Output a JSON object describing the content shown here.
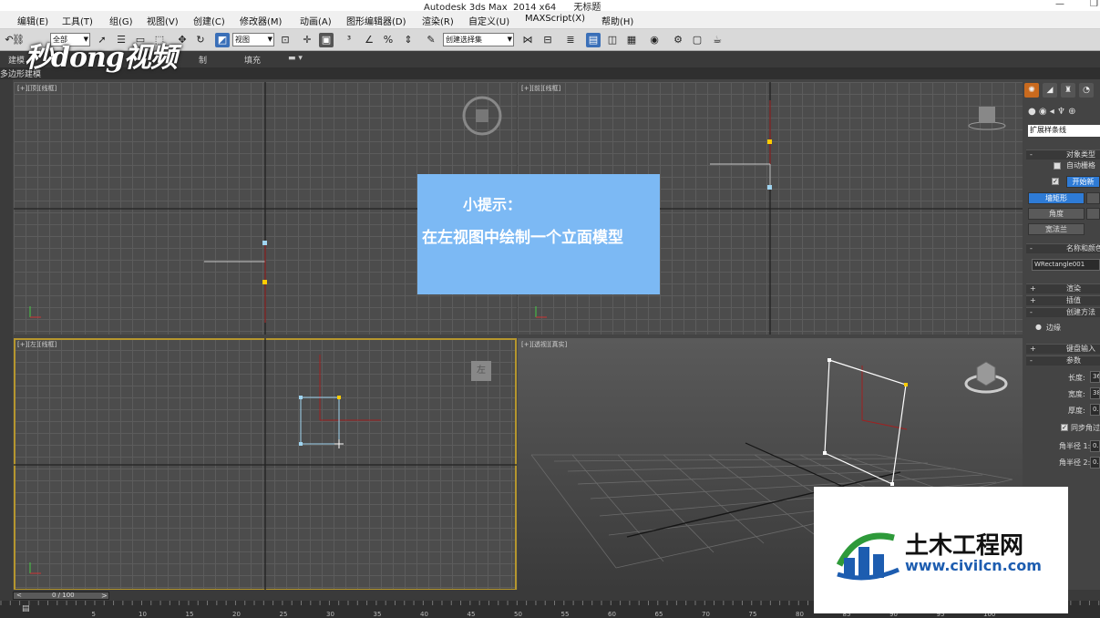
{
  "window": {
    "title": "Autodesk 3ds Max  2014 x64      无标题"
  },
  "menu": [
    "编辑(E)",
    "工具(T)",
    "组(G)",
    "视图(V)",
    "创建(C)",
    "修改器(M)",
    "动画(A)",
    "图形编辑器(D)",
    "渲染(R)",
    "自定义(U)",
    "MAXScript(X)",
    "帮助(H)"
  ],
  "toolbar": {
    "selection_filter": "全部",
    "reference_coord": "视图",
    "named_selection": "创建选择集"
  },
  "ribbon": {
    "tabs": [
      "建模",
      "制",
      "填充"
    ],
    "sub_label": "多边形建模"
  },
  "viewports": [
    {
      "label": "[+][顶][线框]"
    },
    {
      "label": "[+][前][线框]"
    },
    {
      "label": "[+][左][线框]"
    },
    {
      "label": "[+][透视][真实]"
    }
  ],
  "viewcube_labels": {
    "left": "左"
  },
  "tip": {
    "title": "小提示：",
    "text": "在左视图中绘制一个立面模型"
  },
  "command_panel": {
    "category_dropdown": "扩展样条线",
    "object_type_header": "对象类型",
    "auto_grid": "自动栅格",
    "start_new_shape": "开始新",
    "buttons": [
      "墙矩形",
      "角度",
      "宽法兰"
    ],
    "name_color_header": "名称和颜色",
    "object_name": "WRectangle001",
    "rollouts": [
      "渲染",
      "插值",
      "创建方法",
      "键盘输入",
      "参数"
    ],
    "creation_method_option": "边缘",
    "params": [
      {
        "label": "长度:",
        "value": "36"
      },
      {
        "label": "宽度:",
        "value": "38"
      },
      {
        "label": "厚度:",
        "value": "0.0"
      }
    ],
    "sync_corner": "同步角过",
    "corner_radius_1": "角半径 1:",
    "corner_radius_2": "角半径 2:",
    "corner_radius_1_value": "0.0",
    "corner_radius_2_value": "0.0"
  },
  "timeline": {
    "frame": "0 / 100",
    "ruler_ticks": [
      "5",
      "10",
      "15",
      "20",
      "25",
      "30",
      "35",
      "40",
      "45",
      "50",
      "55",
      "60",
      "65",
      "70",
      "75",
      "80",
      "85",
      "90",
      "95",
      "100"
    ]
  },
  "watermarks": {
    "video_logo": "秒dong视频",
    "civil_cn": "土木工程网",
    "civil_url": "www.civilcn.com"
  },
  "colors": {
    "tip_background": "#7cb9f4",
    "active_viewport_border": "#b5962e",
    "command_start_button": "#2e7bd6",
    "shape_selected": "#9fd4f0",
    "vertex_first": "#ffcc00"
  }
}
